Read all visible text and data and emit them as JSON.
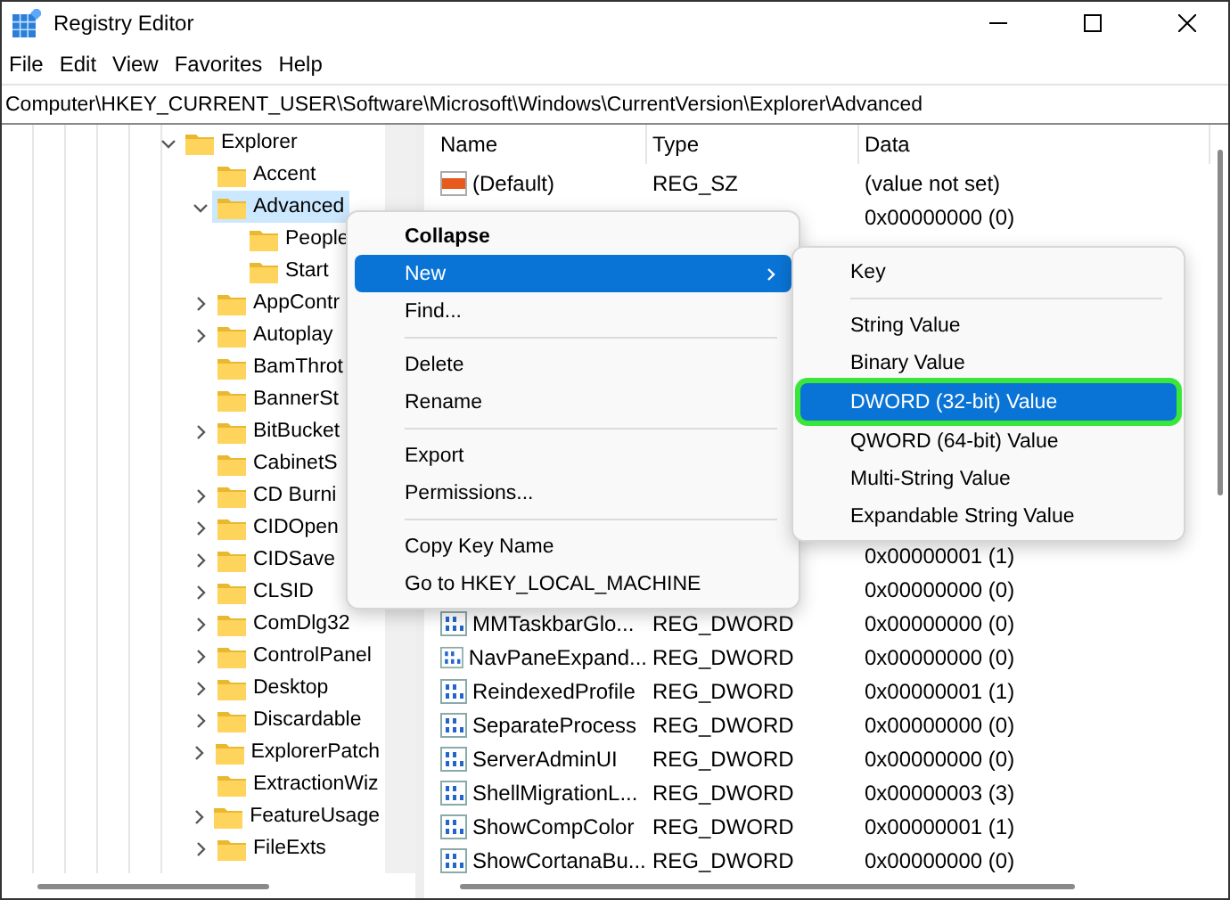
{
  "window": {
    "title": "Registry Editor"
  },
  "menu_bar": [
    "File",
    "Edit",
    "View",
    "Favorites",
    "Help"
  ],
  "address": "Computer\\HKEY_CURRENT_USER\\Software\\Microsoft\\Windows\\CurrentVersion\\Explorer\\Advanced",
  "tree": [
    {
      "label": "Explorer",
      "expandable": true,
      "expanded": true,
      "selected": false,
      "children": [
        {
          "label": "Accent",
          "expandable": false,
          "selected": false
        },
        {
          "label": "Advanced",
          "expandable": true,
          "expanded": true,
          "selected": true,
          "children": [
            {
              "label": "People",
              "expandable": false,
              "selected": false
            },
            {
              "label": "Start",
              "expandable": false,
              "selected": false
            }
          ]
        },
        {
          "label": "AppContr",
          "expandable": true,
          "expanded": false,
          "selected": false
        },
        {
          "label": "Autoplay",
          "expandable": true,
          "expanded": false,
          "selected": false
        },
        {
          "label": "BamThrot",
          "expandable": false,
          "selected": false
        },
        {
          "label": "BannerSt",
          "expandable": false,
          "selected": false
        },
        {
          "label": "BitBucket",
          "expandable": true,
          "expanded": false,
          "selected": false
        },
        {
          "label": "CabinetS",
          "expandable": false,
          "selected": false
        },
        {
          "label": "CD Burni",
          "expandable": true,
          "expanded": false,
          "selected": false
        },
        {
          "label": "CIDOpen",
          "expandable": true,
          "expanded": false,
          "selected": false
        },
        {
          "label": "CIDSave",
          "expandable": true,
          "expanded": false,
          "selected": false
        },
        {
          "label": "CLSID",
          "expandable": true,
          "expanded": false,
          "selected": false
        },
        {
          "label": "ComDlg32",
          "expandable": true,
          "expanded": false,
          "selected": false
        },
        {
          "label": "ControlPanel",
          "expandable": true,
          "expanded": false,
          "selected": false
        },
        {
          "label": "Desktop",
          "expandable": true,
          "expanded": false,
          "selected": false
        },
        {
          "label": "Discardable",
          "expandable": true,
          "expanded": false,
          "selected": false
        },
        {
          "label": "ExplorerPatch",
          "expandable": true,
          "expanded": false,
          "selected": false
        },
        {
          "label": "ExtractionWiz",
          "expandable": false,
          "selected": false
        },
        {
          "label": "FeatureUsage",
          "expandable": true,
          "expanded": false,
          "selected": false
        },
        {
          "label": "FileExts",
          "expandable": true,
          "expanded": false,
          "selected": false
        }
      ]
    }
  ],
  "table": {
    "columns": [
      "Name",
      "Type",
      "Data"
    ],
    "rows": [
      {
        "kind": "string",
        "name": "(Default)",
        "type": "REG_SZ",
        "data": "(value not set)"
      },
      {
        "data": "0x00000000 (0)"
      },
      {},
      {},
      {},
      {},
      {},
      {},
      {},
      {},
      {},
      {
        "data": "0x00000001 (1)"
      },
      {
        "data": "0x00000000 (0)"
      },
      {
        "kind": "dword",
        "name": "MMTaskbarGlo...",
        "type": "REG_DWORD",
        "data": "0x00000000 (0)"
      },
      {
        "kind": "dword",
        "name": "NavPaneExpand...",
        "type": "REG_DWORD",
        "data": "0x00000000 (0)"
      },
      {
        "kind": "dword",
        "name": "ReindexedProfile",
        "type": "REG_DWORD",
        "data": "0x00000001 (1)"
      },
      {
        "kind": "dword",
        "name": "SeparateProcess",
        "type": "REG_DWORD",
        "data": "0x00000000 (0)"
      },
      {
        "kind": "dword",
        "name": "ServerAdminUI",
        "type": "REG_DWORD",
        "data": "0x00000000 (0)"
      },
      {
        "kind": "dword",
        "name": "ShellMigrationL...",
        "type": "REG_DWORD",
        "data": "0x00000003 (3)"
      },
      {
        "kind": "dword",
        "name": "ShowCompColor",
        "type": "REG_DWORD",
        "data": "0x00000001 (1)"
      },
      {
        "kind": "dword",
        "name": "ShowCortanaBu...",
        "type": "REG_DWORD",
        "data": "0x00000000 (0)"
      }
    ]
  },
  "context_menu": [
    {
      "kind": "item",
      "label": "Collapse",
      "default": true,
      "selected": false,
      "submenu": false
    },
    {
      "kind": "item",
      "label": "New",
      "default": false,
      "selected": true,
      "submenu": true
    },
    {
      "kind": "item",
      "label": "Find...",
      "default": false,
      "selected": false,
      "submenu": false
    },
    {
      "kind": "separator"
    },
    {
      "kind": "item",
      "label": "Delete",
      "default": false,
      "selected": false,
      "submenu": false
    },
    {
      "kind": "item",
      "label": "Rename",
      "default": false,
      "selected": false,
      "submenu": false
    },
    {
      "kind": "separator"
    },
    {
      "kind": "item",
      "label": "Export",
      "default": false,
      "selected": false,
      "submenu": false
    },
    {
      "kind": "item",
      "label": "Permissions...",
      "default": false,
      "selected": false,
      "submenu": false
    },
    {
      "kind": "separator"
    },
    {
      "kind": "item",
      "label": "Copy Key Name",
      "default": false,
      "selected": false,
      "submenu": false
    },
    {
      "kind": "item",
      "label": "Go to HKEY_LOCAL_MACHINE",
      "default": false,
      "selected": false,
      "submenu": false
    }
  ],
  "submenu": [
    {
      "kind": "item",
      "label": "Key",
      "selected": false,
      "highlighted": false
    },
    {
      "kind": "separator"
    },
    {
      "kind": "item",
      "label": "String Value",
      "selected": false,
      "highlighted": false
    },
    {
      "kind": "item",
      "label": "Binary Value",
      "selected": false,
      "highlighted": false
    },
    {
      "kind": "item",
      "label": "DWORD (32-bit) Value",
      "selected": true,
      "highlighted": true
    },
    {
      "kind": "item",
      "label": "QWORD (64-bit) Value",
      "selected": false,
      "highlighted": false
    },
    {
      "kind": "item",
      "label": "Multi-String Value",
      "selected": false,
      "highlighted": false
    },
    {
      "kind": "item",
      "label": "Expandable String Value",
      "selected": false,
      "highlighted": false
    }
  ]
}
